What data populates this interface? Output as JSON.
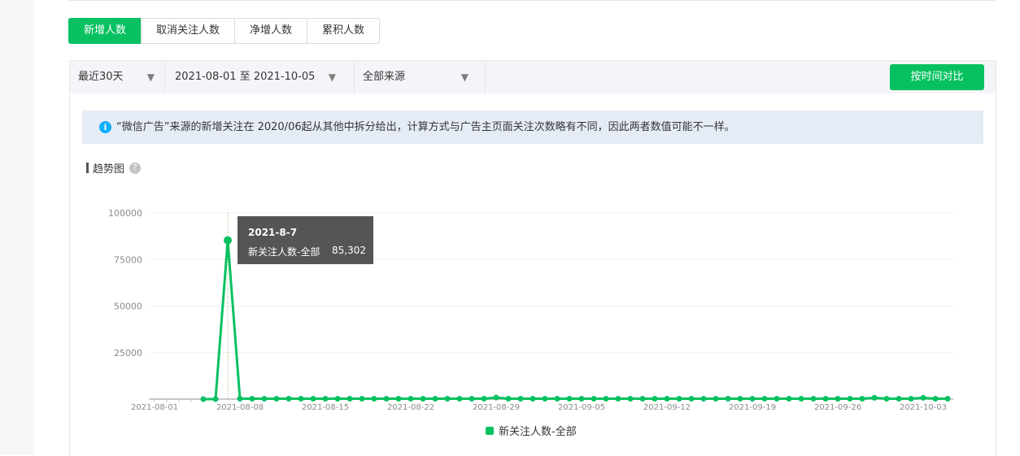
{
  "tabs": [
    {
      "label": "新增人数",
      "active": true
    },
    {
      "label": "取消关注人数"
    },
    {
      "label": "净增人数"
    },
    {
      "label": "累积人数"
    }
  ],
  "filters": {
    "range": "最近30天",
    "dates": "2021-08-01 至 2021-10-05",
    "source": "全部来源",
    "compare_button": "按时间对比"
  },
  "notice": "“微信广告”来源的新增关注在 2020/06起从其他中拆分给出，计算方式与广告主页面关注次数略有不同，因此两者数值可能不一样。",
  "section_title": "趋势图",
  "tooltip": {
    "date": "2021-8-7",
    "series": "新关注人数-全部",
    "value": "85,302"
  },
  "colors": {
    "accent": "#07c160"
  },
  "chart_data": {
    "type": "line",
    "start_date": "2021-08-01",
    "x_ticks": [
      "2021-08-01",
      "2021-08-08",
      "2021-08-15",
      "2021-08-22",
      "2021-08-29",
      "2021-09-05",
      "2021-09-12",
      "2021-09-19",
      "2021-09-26",
      "2021-10-03"
    ],
    "y_ticks": [
      25000,
      50000,
      75000,
      100000
    ],
    "ylim": [
      0,
      100000
    ],
    "series": [
      {
        "name": "新关注人数-全部",
        "values": [
          null,
          null,
          null,
          null,
          0,
          0,
          85302,
          200,
          200,
          200,
          200,
          200,
          200,
          200,
          200,
          200,
          200,
          200,
          200,
          200,
          200,
          200,
          200,
          200,
          200,
          200,
          200,
          200,
          800,
          200,
          200,
          200,
          200,
          200,
          200,
          200,
          200,
          200,
          200,
          200,
          200,
          200,
          200,
          200,
          200,
          200,
          200,
          200,
          200,
          200,
          200,
          200,
          200,
          200,
          200,
          200,
          200,
          200,
          200,
          700,
          200,
          200,
          200,
          700,
          200,
          200
        ]
      }
    ],
    "legend": "bottom-center"
  }
}
